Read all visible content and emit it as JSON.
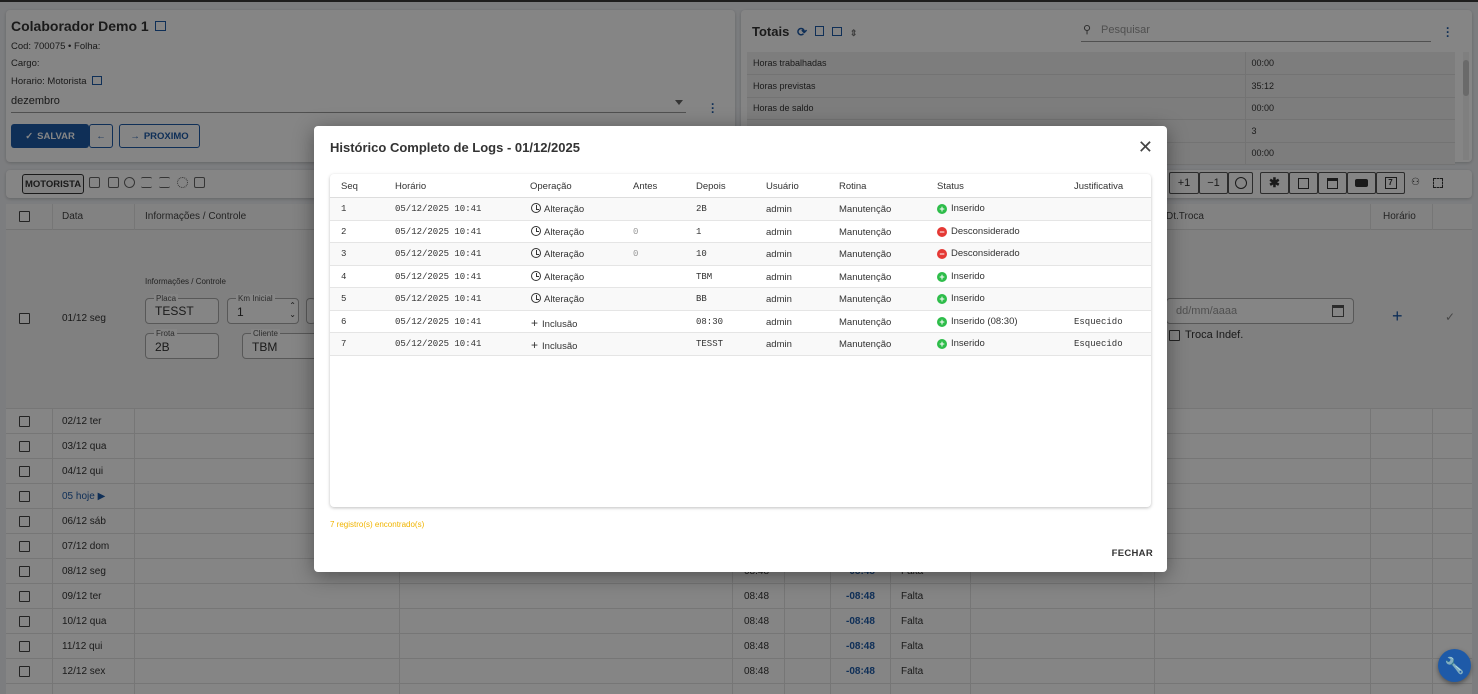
{
  "collaborator": {
    "name": "Colaborador Demo 1",
    "cod_line": "Cod: 700075 • Folha:",
    "cargo_line": "Cargo:",
    "horario_line": "Horario: Motorista",
    "month": "dezembro",
    "save_label": "SALVAR",
    "next_label": "PROXIMO"
  },
  "totais": {
    "title": "Totais",
    "search_placeholder": "Pesquisar",
    "rows": [
      {
        "label": "Horas trabalhadas",
        "value": "00:00"
      },
      {
        "label": "Horas previstas",
        "value": "35:12"
      },
      {
        "label": "Horas de saldo",
        "value": "00:00"
      },
      {
        "label": "",
        "value": "3"
      },
      {
        "label": "",
        "value": "00:00"
      }
    ]
  },
  "toolbar": {
    "motorista_label": "MOTORISTA",
    "plus_one": "+1",
    "minus_one": "−1"
  },
  "grid": {
    "headers": {
      "data": "Data",
      "info": "Informações / Controle",
      "dt_troca": "Dt.Troca",
      "horario": "Horário"
    },
    "expanded_row": {
      "date": "01/12 seg",
      "section_label": "Informações / Controle",
      "placa_label": "Placa",
      "placa_value": "TESST",
      "km_label": "Km Inicial",
      "km_value": "1",
      "frota_label": "Frota",
      "frota_value": "2B",
      "cliente_label": "Cliente",
      "cliente_value": "TBM",
      "date_placeholder": "dd/mm/aaaa",
      "troca_indef": "Troca Indef."
    },
    "rows": [
      {
        "date": "02/12 ter"
      },
      {
        "date": "03/12 qua"
      },
      {
        "date": "04/12 qui"
      },
      {
        "date": "05 hoje ▶"
      },
      {
        "date": "06/12 sáb"
      },
      {
        "date": "07/12 dom"
      },
      {
        "date": "08/12 seg",
        "time": "08:48",
        "balance": "-08:48",
        "status": "Falta"
      },
      {
        "date": "09/12 ter",
        "time": "08:48",
        "balance": "-08:48",
        "status": "Falta"
      },
      {
        "date": "10/12 qua",
        "time": "08:48",
        "balance": "-08:48",
        "status": "Falta"
      },
      {
        "date": "11/12 qui",
        "time": "08:48",
        "balance": "-08:48",
        "status": "Falta"
      },
      {
        "date": "12/12 sex",
        "time": "08:48",
        "balance": "-08:48",
        "status": "Falta"
      }
    ]
  },
  "modal": {
    "title": "Histórico Completo de Logs - 01/12/2025",
    "columns": [
      "Seq",
      "Horário",
      "Operação",
      "Antes",
      "Depois",
      "Usuário",
      "Rotina",
      "Status",
      "Justificativa"
    ],
    "rows": [
      {
        "seq": "1",
        "horario": "05/12/2025 10:41",
        "operacao": "Alteração",
        "op_icon": "clock-icon",
        "antes": "",
        "depois": "2B",
        "usuario": "admin",
        "rotina": "Manutenção",
        "status": "Inserido",
        "status_type": "ok",
        "justificativa": ""
      },
      {
        "seq": "2",
        "horario": "05/12/2025 10:41",
        "operacao": "Alteração",
        "op_icon": "clock-icon",
        "antes": "0",
        "depois": "1",
        "usuario": "admin",
        "rotina": "Manutenção",
        "status": "Desconsiderado",
        "status_type": "warn",
        "justificativa": ""
      },
      {
        "seq": "3",
        "horario": "05/12/2025 10:41",
        "operacao": "Alteração",
        "op_icon": "clock-icon",
        "antes": "0",
        "depois": "10",
        "usuario": "admin",
        "rotina": "Manutenção",
        "status": "Desconsiderado",
        "status_type": "warn",
        "justificativa": ""
      },
      {
        "seq": "4",
        "horario": "05/12/2025 10:41",
        "operacao": "Alteração",
        "op_icon": "clock-icon",
        "antes": "",
        "depois": "TBM",
        "usuario": "admin",
        "rotina": "Manutenção",
        "status": "Inserido",
        "status_type": "ok",
        "justificativa": ""
      },
      {
        "seq": "5",
        "horario": "05/12/2025 10:41",
        "operacao": "Alteração",
        "op_icon": "clock-icon",
        "antes": "",
        "depois": "BB",
        "usuario": "admin",
        "rotina": "Manutenção",
        "status": "Inserido",
        "status_type": "ok",
        "justificativa": ""
      },
      {
        "seq": "6",
        "horario": "05/12/2025 10:41",
        "operacao": "Inclusão",
        "op_icon": "plus-icon",
        "antes": "",
        "depois": "08:30",
        "usuario": "admin",
        "rotina": "Manutenção",
        "status": "Inserido (08:30)",
        "status_type": "ok",
        "justificativa": "Esquecido"
      },
      {
        "seq": "7",
        "horario": "05/12/2025 10:41",
        "operacao": "Inclusão",
        "op_icon": "plus-icon",
        "antes": "",
        "depois": "TESST",
        "usuario": "admin",
        "rotina": "Manutenção",
        "status": "Inserido",
        "status_type": "ok",
        "justificativa": "Esquecido"
      }
    ],
    "found_text": "7 registro(s) encontrado(s)",
    "close_label": "FECHAR"
  },
  "colors": {
    "primary": "#1e5aa8",
    "ok": "#2ebd4a",
    "warn": "#e68a00",
    "error": "#e53935",
    "found": "#f0b400"
  }
}
